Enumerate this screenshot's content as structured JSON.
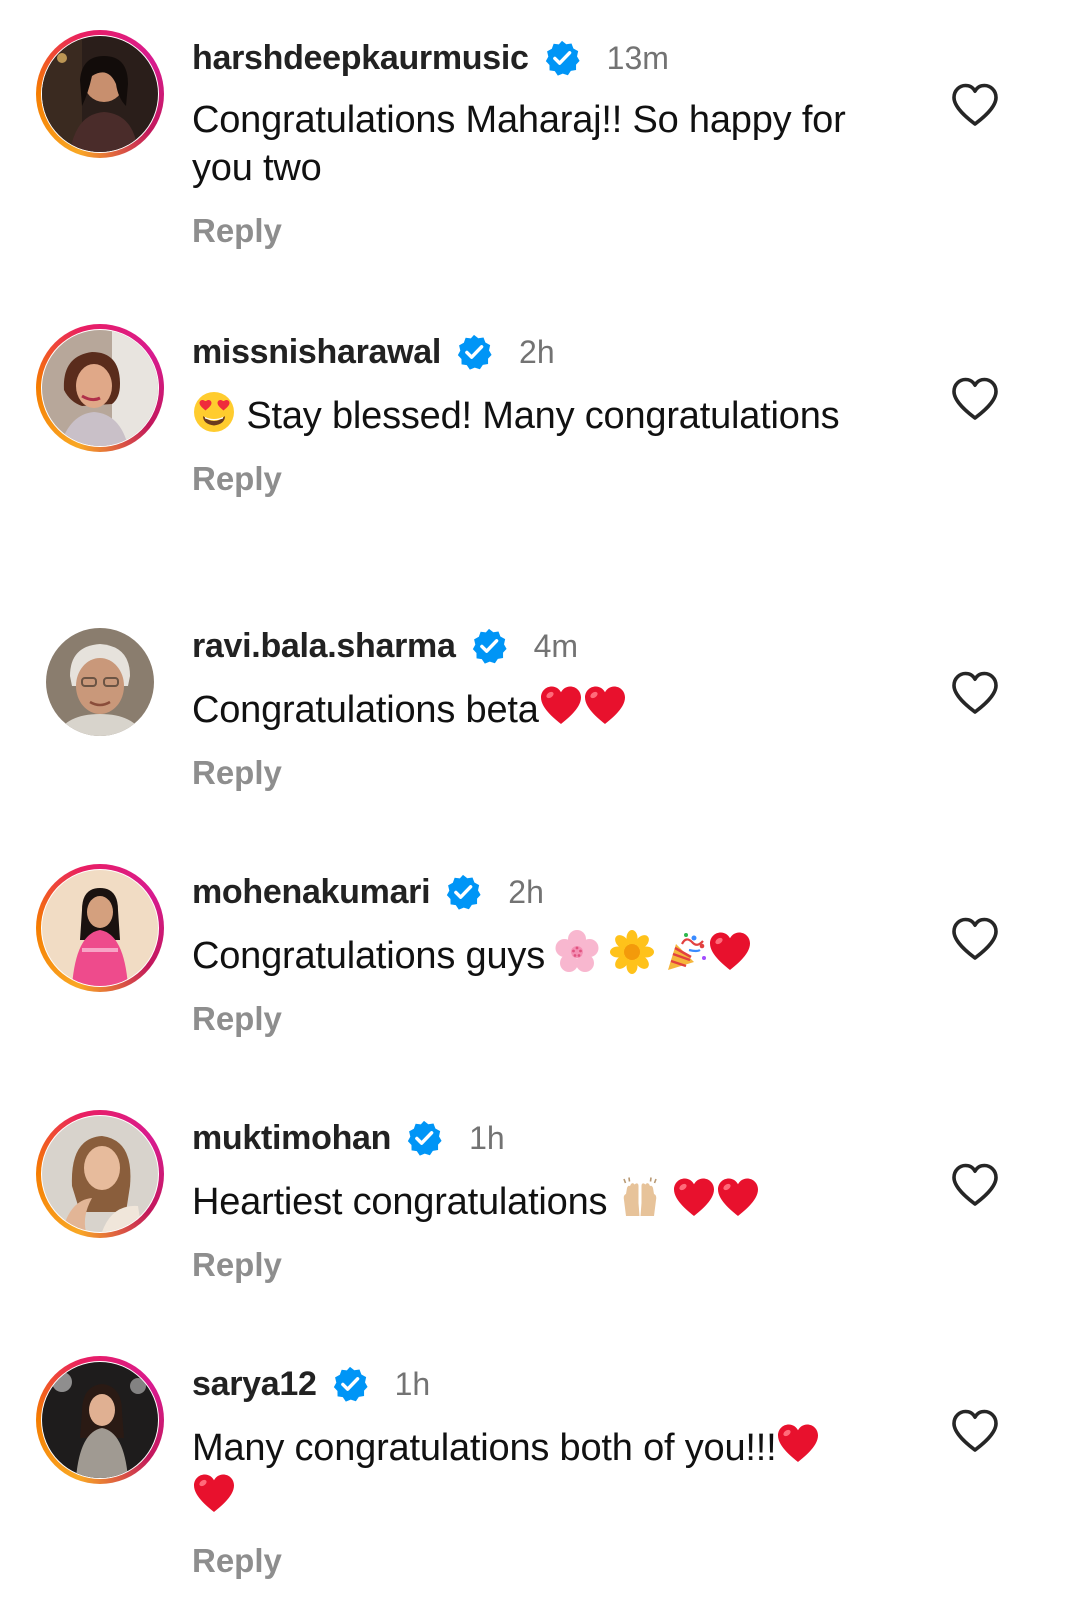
{
  "reply_label": "Reply",
  "colors": {
    "verified": "#0095f6",
    "muted": "#737373",
    "ring_start": "#f9a825",
    "ring_end": "#d81b8f"
  },
  "icons": {
    "verified": "verified-badge-icon",
    "like": "heart-outline-icon"
  },
  "comments": [
    {
      "username": "harshdeepkaurmusic",
      "verified": true,
      "time": "13m",
      "text": "Congratulations Maharaj!! So happy for you two",
      "emojis_after": [],
      "story_ring": true
    },
    {
      "username": "missnisharawal",
      "verified": true,
      "time": "2h",
      "text": "Stay blessed! Many congratulations",
      "emojis_before": [
        "heart-eyes"
      ],
      "story_ring": true
    },
    {
      "username": "ravi.bala.sharma",
      "verified": true,
      "time": "4m",
      "text": "Congratulations beta",
      "emojis_after": [
        "red-heart",
        "red-heart"
      ],
      "story_ring": false
    },
    {
      "username": "mohenakumari",
      "verified": true,
      "time": "2h",
      "text": "Congratulations guys ",
      "emojis_after": [
        "cherry-blossom",
        "blossom",
        "party-popper",
        "red-heart"
      ],
      "story_ring": true
    },
    {
      "username": "muktimohan",
      "verified": true,
      "time": "1h",
      "text": "Heartiest congratulations ",
      "emojis_after": [
        "raising-hands",
        "red-heart",
        "red-heart"
      ],
      "story_ring": true
    },
    {
      "username": "sarya12",
      "verified": true,
      "time": "1h",
      "text": "Many congratulations both of you!!!",
      "emojis_after": [
        "red-heart",
        "red-heart"
      ],
      "story_ring": true
    }
  ]
}
